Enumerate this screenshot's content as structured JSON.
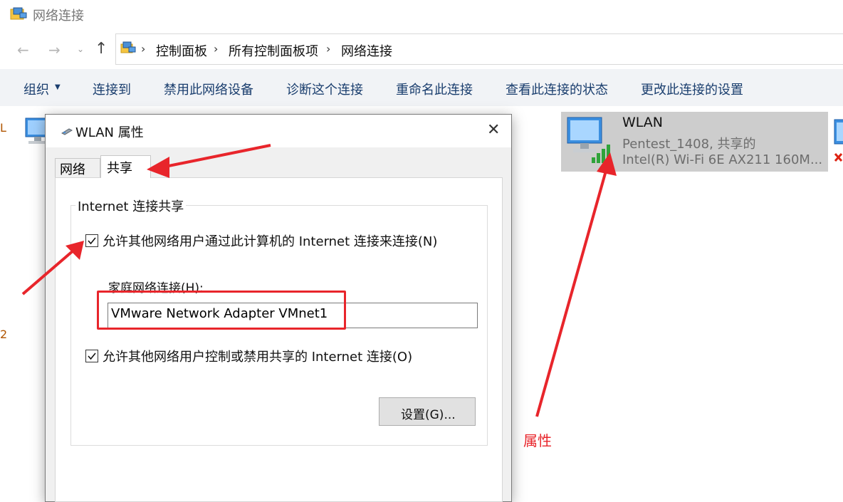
{
  "window": {
    "title": "网络连接"
  },
  "nav": {
    "back": "←",
    "forward": "→",
    "recent": "⌄",
    "up": "↑"
  },
  "breadcrumb": {
    "items": [
      "控制面板",
      "所有控制面板项",
      "网络连接"
    ],
    "separator": "›"
  },
  "commandbar": {
    "organize": "组织",
    "items": [
      "连接到",
      "禁用此网络设备",
      "诊断这个连接",
      "重命名此连接",
      "查看此连接的状态",
      "更改此连接的设置"
    ]
  },
  "wlan_tile": {
    "name": "WLAN",
    "line2": "Pentest_1408, 共享的",
    "line3": "Intel(R) Wi-Fi 6E AX211 160M..."
  },
  "dialog": {
    "title": "WLAN 属性",
    "close": "✕",
    "tabs": [
      "网络",
      "共享"
    ],
    "active_tab": "共享",
    "group_title": "Internet 连接共享",
    "checkbox1": {
      "label": "允许其他网络用户通过此计算机的 Internet 连接来连接(N)",
      "checked": true
    },
    "home_label": "家庭网络连接(H):",
    "home_value": "VMware Network Adapter VMnet1",
    "checkbox2": {
      "label": "允许其他网络用户控制或禁用共享的 Internet 连接(O)",
      "checked": true
    },
    "settings_button": "设置(G)..."
  },
  "annotation": {
    "label": "属性",
    "color": "#e8252b"
  },
  "icons": [
    "network-folder-icon",
    "network-connections-icon",
    "wifi-signal-icon",
    "checkbox-check-icon",
    "network-adapter-icon"
  ]
}
